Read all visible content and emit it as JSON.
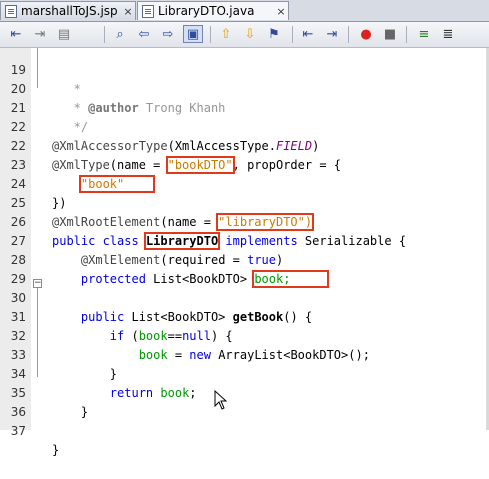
{
  "tabs": [
    {
      "label": "marshallToJS.jsp",
      "close": "×",
      "active": false
    },
    {
      "label": "LibraryDTO.java",
      "close": "×",
      "active": true
    }
  ],
  "toolbar": {
    "buttons": [
      "back-icon",
      "forward-icon",
      "history-icon",
      "find-icon",
      "find-previous-icon",
      "find-next-icon",
      "toggle-highlight-icon",
      "previous-bookmark-icon",
      "next-bookmark-icon",
      "toggle-bookmark-icon",
      "shift-left-icon",
      "shift-right-icon",
      "macro-record-icon",
      "macro-stop-icon",
      "comment-icon",
      "uncomment-icon"
    ]
  },
  "code_lines": [
    {
      "n": "19",
      "t": "   *"
    },
    {
      "n": "20",
      "t": "   * @author Trong Khanh"
    },
    {
      "n": "21",
      "t": "   */"
    },
    {
      "n": "22",
      "t": "@XmlAccessorType(XmlAccessType.FIELD)"
    },
    {
      "n": "22",
      "t": "@XmlType(name = \"bookDTO\", propOrder = {"
    },
    {
      "n": "23",
      "t": "    \"book\""
    },
    {
      "n": "24",
      "t": "})"
    },
    {
      "n": "25",
      "t": "@XmlRootElement(name = \"libraryDTO\")"
    },
    {
      "n": "26",
      "t": "public class LibraryDTO implements Serializable {"
    },
    {
      "n": "27",
      "t": "    @XmlElement(required = true)"
    },
    {
      "n": "28",
      "t": "    protected List<BookDTO> book;"
    },
    {
      "n": "29",
      "t": ""
    },
    {
      "n": "30",
      "t": "    public List<BookDTO> getBook() {"
    },
    {
      "n": "31",
      "t": "        if (book==null) {"
    },
    {
      "n": "32",
      "t": "            book = new ArrayList<BookDTO>();"
    },
    {
      "n": "33",
      "t": "        }"
    },
    {
      "n": "34",
      "t": "        return book;"
    },
    {
      "n": "35",
      "t": "    }"
    },
    {
      "n": "36",
      "t": ""
    },
    {
      "n": "37",
      "t": "}"
    }
  ],
  "colors": {
    "highlight_box": "#e2391b",
    "keyword": "#0000e6",
    "string": "#ce7b00",
    "comment": "#969696"
  }
}
